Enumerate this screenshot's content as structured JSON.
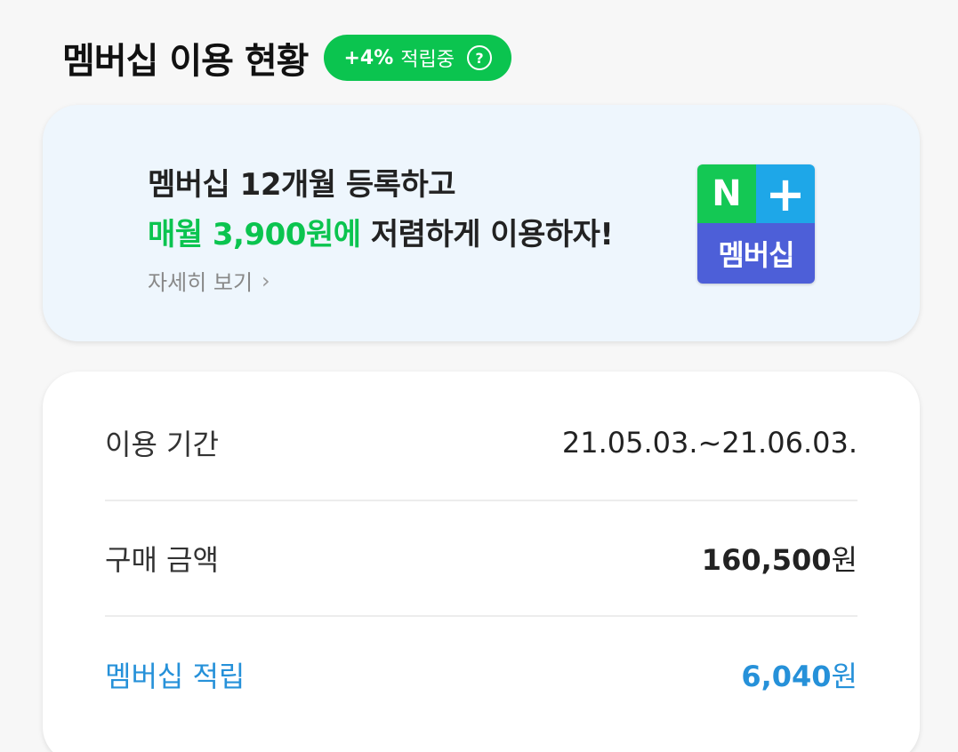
{
  "header": {
    "title": "멤버십 이용 현황",
    "badge": {
      "percent": "+4%",
      "label": "적립중",
      "help_icon": "question-circle-icon"
    }
  },
  "promo": {
    "line1": "멤버십 12개월 등록하고",
    "line2_highlight": "매월 3,900원에",
    "line2_rest": " 저렴하게 이용하자!",
    "more_label": "자세히 보기",
    "more_icon": "chevron-right-icon",
    "logo": {
      "top_left": "N",
      "top_right": "+",
      "bottom": "멤버십"
    }
  },
  "info": {
    "rows": [
      {
        "label": "이용 기간",
        "value": "21.05.03.~21.06.03."
      },
      {
        "label": "구매 금액",
        "value_number": "160,500",
        "value_unit": "원"
      },
      {
        "label": "멤버십 적립",
        "value_number": "6,040",
        "value_unit": "원"
      }
    ]
  },
  "colors": {
    "accent_green": "#0bc44f",
    "accent_blue": "#2691d9",
    "logo_green": "#14c854",
    "logo_cyan": "#1ea7e8",
    "logo_indigo": "#4d5fd8"
  }
}
